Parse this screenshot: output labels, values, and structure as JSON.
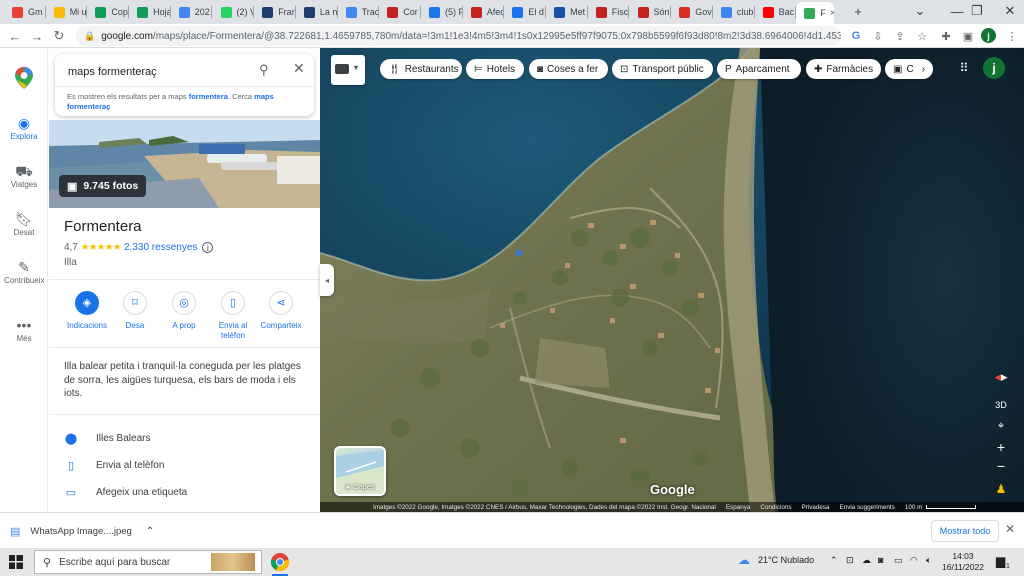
{
  "browser": {
    "tabs": [
      {
        "label": "Gm",
        "color": "#ea4335"
      },
      {
        "label": "Mi u",
        "color": "#fbbc04"
      },
      {
        "label": "Cop",
        "color": "#0f9d58"
      },
      {
        "label": "Hoja",
        "color": "#0f9d58"
      },
      {
        "label": "202",
        "color": "#4285f4"
      },
      {
        "label": "(2) V",
        "color": "#25d366"
      },
      {
        "label": "Fran",
        "color": "#1f3a6e"
      },
      {
        "label": "La n",
        "color": "#1f3a6e"
      },
      {
        "label": "Trac",
        "color": "#4285f4"
      },
      {
        "label": "Cor",
        "color": "#c5221f"
      },
      {
        "label": "(5) F",
        "color": "#1877f2"
      },
      {
        "label": "Afec",
        "color": "#c5221f"
      },
      {
        "label": "El d",
        "color": "#1a73e8"
      },
      {
        "label": "Met",
        "color": "#174ea6"
      },
      {
        "label": "Fisc",
        "color": "#c5221f"
      },
      {
        "label": "Són",
        "color": "#c5221f"
      },
      {
        "label": "Gov",
        "color": "#d93025"
      },
      {
        "label": "club",
        "color": "#4285f4"
      },
      {
        "label": "Bac",
        "color": "#ff0000"
      },
      {
        "label": "F",
        "color": "#34a853"
      }
    ],
    "active_tab_close": "×",
    "new_tab": "+",
    "url_host": "google.com",
    "url_rest": "/maps/place/Formentera/@38.722681,1.4659785,780m/data=!3m1!1e3!4m5!3m4!1s0x12995e5ff97f9075:0x798b5599f6f93d80!8m2!3d38.6964006!4d1.4531355",
    "profile_initial": "j"
  },
  "rail": {
    "items": [
      {
        "label": "Explora",
        "icon": "compass-icon"
      },
      {
        "label": "Viatges",
        "icon": "car-icon"
      },
      {
        "label": "Desat",
        "icon": "bookmark-icon"
      },
      {
        "label": "Contribueix",
        "icon": "edit-icon"
      },
      {
        "label": "Més",
        "icon": "more-icon"
      }
    ]
  },
  "search": {
    "value": "maps formenteraç",
    "hint_prefix": "Es mostren els resultats per a maps ",
    "hint_bold1": "formentera",
    "hint_mid": ". Cerca ",
    "hint_link": "maps formenteraç"
  },
  "place": {
    "photos": "9.745 fotos",
    "title": "Formentera",
    "rating": "4,7",
    "stars": "★★★★★",
    "reviews": "2.330 ressenyes",
    "type": "Illa",
    "description": "Illa balear petita i tranquil·la coneguda per les platges de sorra, les aigües turquesa, els bars de moda i els iots.",
    "actions": [
      {
        "label": "Indicacions",
        "icon": "directions-icon"
      },
      {
        "label": "Desa",
        "icon": "bookmark-icon"
      },
      {
        "label": "A prop",
        "icon": "nearby-icon"
      },
      {
        "label": "Envia al telèfon",
        "icon": "phone-icon"
      },
      {
        "label": "Comparteix",
        "icon": "share-icon"
      }
    ],
    "info": [
      {
        "label": "Illes Balears",
        "icon": "location-pin-icon"
      },
      {
        "label": "Envia al telèfon",
        "icon": "phone-icon"
      },
      {
        "label": "Afegeix una etiqueta",
        "icon": "label-icon"
      }
    ]
  },
  "map": {
    "chips": [
      {
        "label": "Restaurants",
        "icon": "fork-knife-icon"
      },
      {
        "label": "Hotels",
        "icon": "bed-icon"
      },
      {
        "label": "Coses a fer",
        "icon": "camera-icon"
      },
      {
        "label": "Transport públic",
        "icon": "transit-icon"
      },
      {
        "label": "Aparcament",
        "icon": "parking-icon"
      },
      {
        "label": "Farmàcies",
        "icon": "pharmacy-icon"
      },
      {
        "label": "C",
        "icon": "atm-icon"
      }
    ],
    "layers_label": "Capes",
    "logo": "Google",
    "ctrl_3d": "3D",
    "attribution": [
      "Imatges ©2022 Google, Imatges ©2022 CNES / Airbus, Maxar Technologies, Dades del mapa ©2022 Inst. Geogr. Nacional",
      "Espanya",
      "Condicions",
      "Privadesa",
      "Envia suggeriments",
      "100 m"
    ]
  },
  "downloads": {
    "file": "WhatsApp Image....jpeg",
    "show_all": "Mostrar todo"
  },
  "taskbar": {
    "search_placeholder": "Escribe aquí para buscar",
    "weather": "21°C  Nublado",
    "time": "14:03",
    "date": "16/11/2022",
    "notif_count": "1"
  }
}
